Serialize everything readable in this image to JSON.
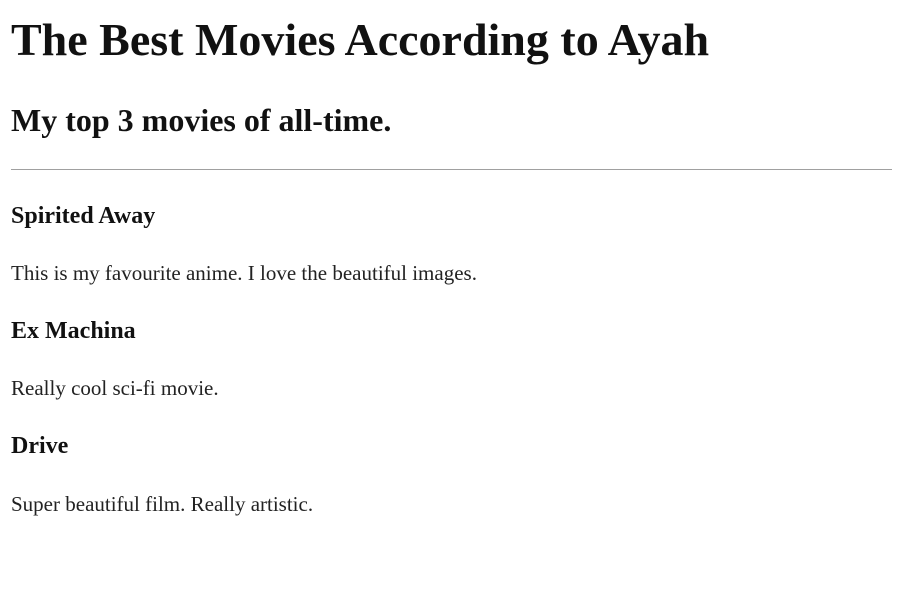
{
  "page": {
    "title": "The Best Movies According to Ayah",
    "subtitle": "My top 3 movies of all-time."
  },
  "movies": [
    {
      "title": "Spirited Away",
      "description": "This is my favourite anime. I love the beautiful images."
    },
    {
      "title": "Ex Machina",
      "description": "Really cool sci-fi movie."
    },
    {
      "title": "Drive",
      "description": "Super beautiful film. Really artistic."
    }
  ]
}
